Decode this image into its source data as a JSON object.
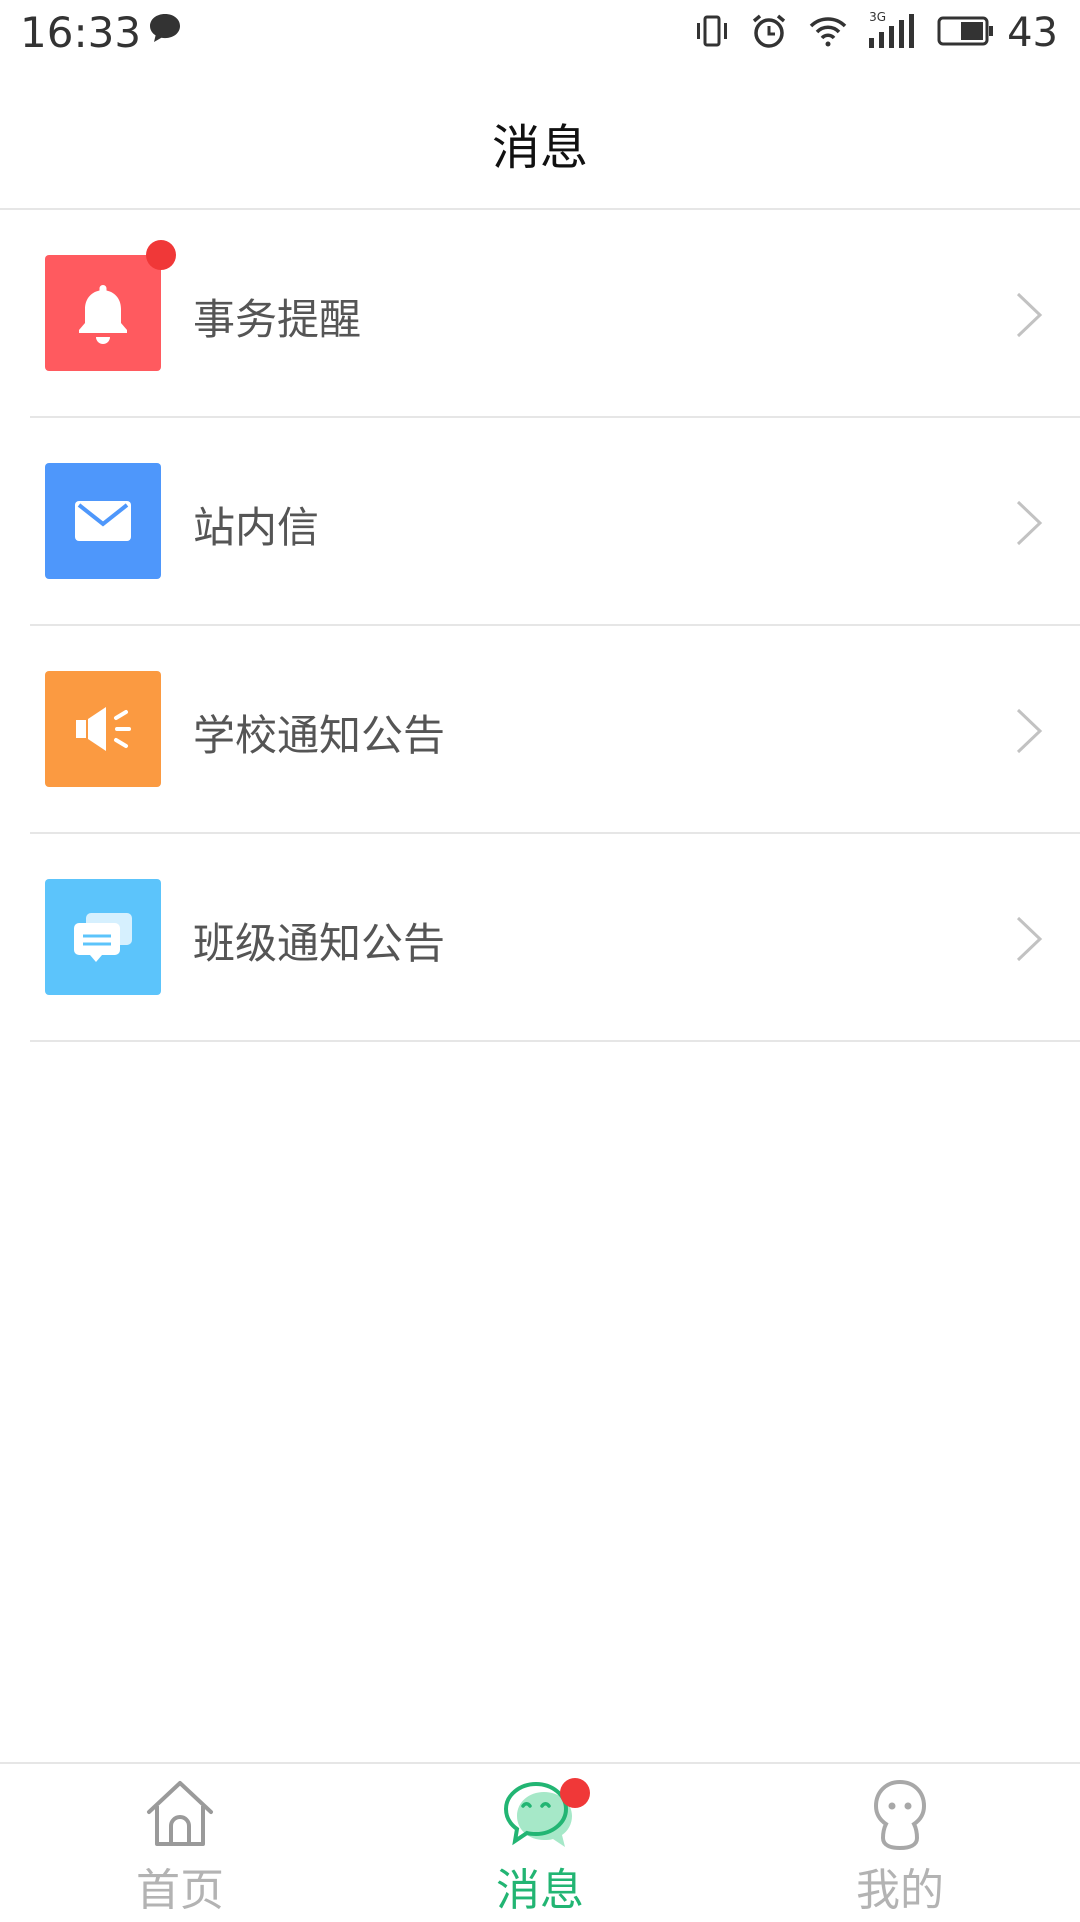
{
  "status_bar": {
    "time": "16:33",
    "network": "3G",
    "battery": "43",
    "icons": [
      "chat-bubble-icon",
      "vibrate-icon",
      "alarm-icon",
      "wifi-icon",
      "signal-icon",
      "battery-icon"
    ]
  },
  "header": {
    "title": "消息"
  },
  "list": {
    "items": [
      {
        "label": "事务提醒",
        "icon": "bell-icon",
        "color": "#ff5a5f",
        "has_badge": true
      },
      {
        "label": "站内信",
        "icon": "mail-icon",
        "color": "#4e97fb"
      },
      {
        "label": "学校通知公告",
        "icon": "speaker-icon",
        "color": "#fb9a41"
      },
      {
        "label": "班级通知公告",
        "icon": "chat-cards-icon",
        "color": "#5cc4fb"
      }
    ]
  },
  "tabbar": {
    "tabs": [
      {
        "label": "首页",
        "icon": "home-icon",
        "active": false
      },
      {
        "label": "消息",
        "icon": "message-icon",
        "active": true,
        "has_badge": true
      },
      {
        "label": "我的",
        "icon": "profile-icon",
        "active": false
      }
    ],
    "active_color": "#22b573",
    "inactive_color": "#b3b3b3"
  }
}
